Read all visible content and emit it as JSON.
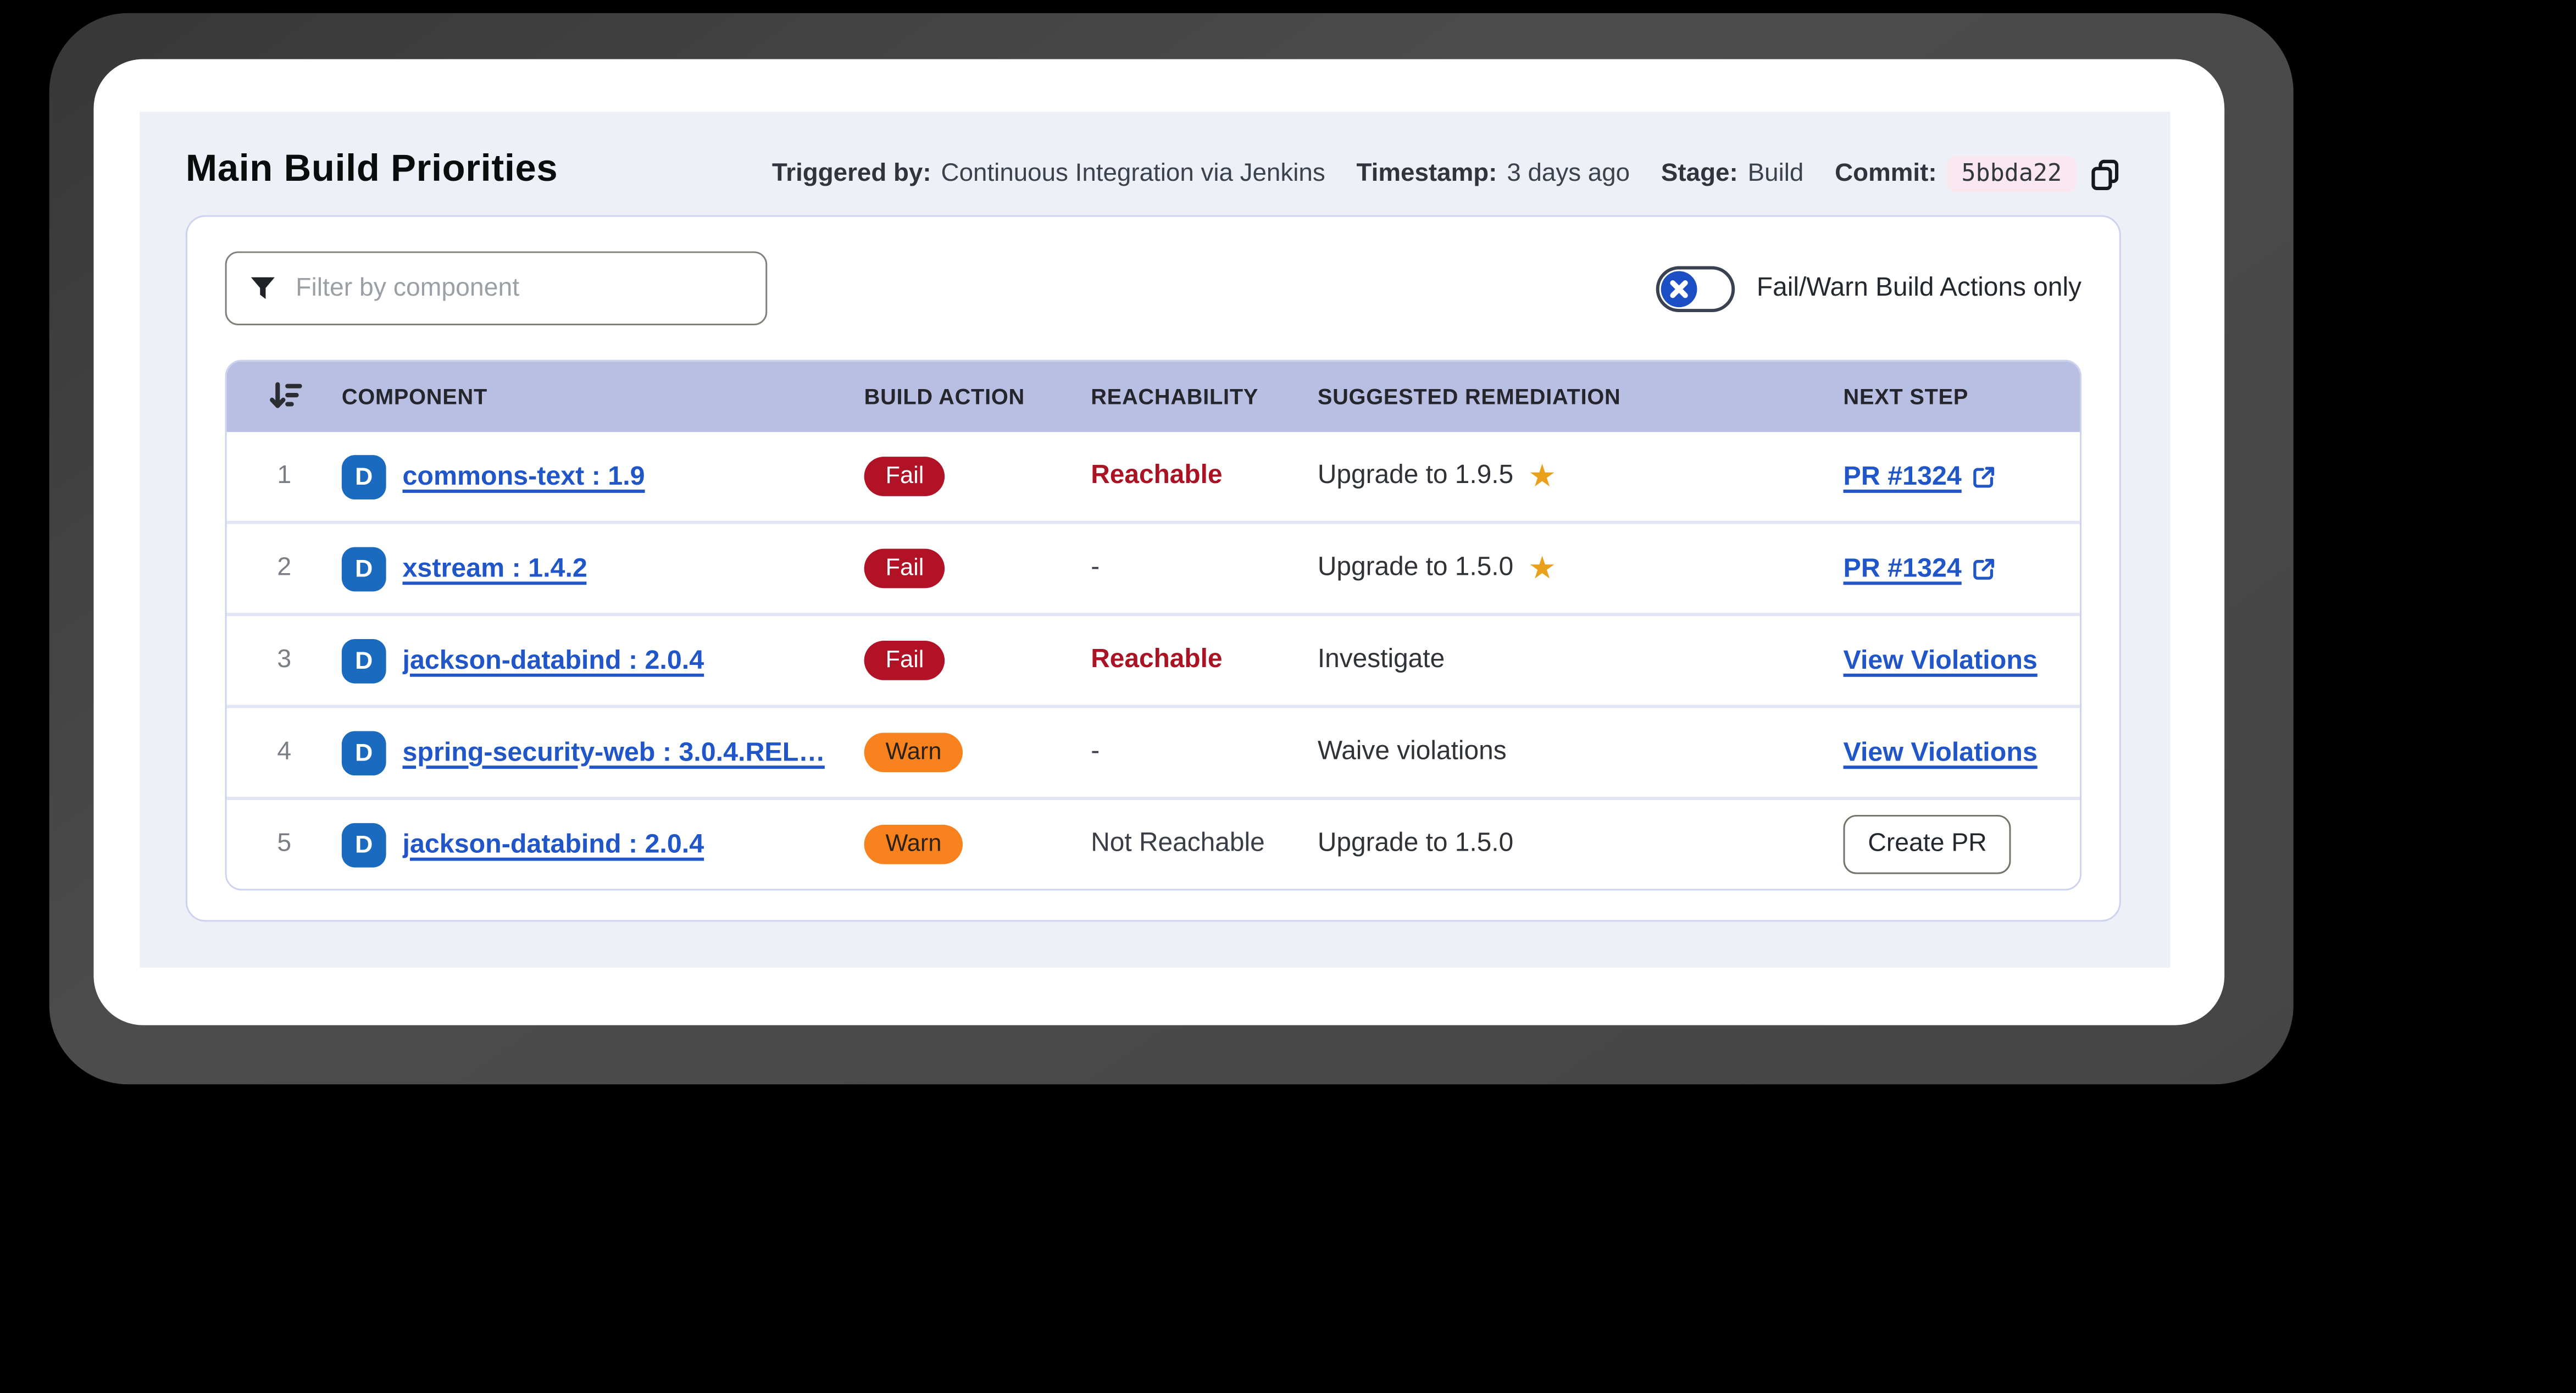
{
  "header": {
    "title": "Main Build Priorities",
    "meta": [
      {
        "label": "Triggered by:",
        "value": "Continuous Integration via Jenkins"
      },
      {
        "label": "Timestamp:",
        "value": "3 days ago"
      },
      {
        "label": "Stage:",
        "value": "Build"
      },
      {
        "label": "Commit:",
        "value": "5bbda22"
      }
    ]
  },
  "toolbar": {
    "filter_placeholder": "Filter by component",
    "toggle_label": "Fail/Warn Build Actions only",
    "toggle_checked": false
  },
  "table": {
    "columns": [
      "COMPONENT",
      "BUILD ACTION",
      "REACHABILITY",
      "SUGGESTED REMEDIATION",
      "NEXT STEP"
    ],
    "rows": [
      {
        "rank": "1",
        "component": "commons-text : 1.9",
        "build_action": "Fail",
        "reachability": "Reachable",
        "reachability_style": "danger",
        "remediation": "Upgrade to 1.9.5",
        "starred": true,
        "next_step": {
          "type": "pr-link",
          "label": "PR #1324"
        }
      },
      {
        "rank": "2",
        "component": "xstream : 1.4.2",
        "build_action": "Fail",
        "reachability": "-",
        "reachability_style": "plain",
        "remediation": "Upgrade to 1.5.0",
        "starred": true,
        "next_step": {
          "type": "pr-link",
          "label": "PR #1324"
        }
      },
      {
        "rank": "3",
        "component": "jackson-databind : 2.0.4",
        "build_action": "Fail",
        "reachability": "Reachable",
        "reachability_style": "danger",
        "remediation": "Investigate",
        "starred": false,
        "next_step": {
          "type": "link",
          "label": "View Violations"
        }
      },
      {
        "rank": "4",
        "component": "spring-security-web : 3.0.4.REL…",
        "build_action": "Warn",
        "reachability": "-",
        "reachability_style": "plain",
        "remediation": "Waive violations",
        "starred": false,
        "next_step": {
          "type": "link",
          "label": "View Violations"
        }
      },
      {
        "rank": "5",
        "component": "jackson-databind : 2.0.4",
        "build_action": "Warn",
        "reachability": "Not Reachable",
        "reachability_style": "plain",
        "remediation": "Upgrade to 1.5.0",
        "starred": false,
        "next_step": {
          "type": "button",
          "label": "Create PR"
        }
      }
    ]
  },
  "colors": {
    "card-bg": "#eef0f7",
    "header-lavender": "#b9bee3",
    "fail-badge": "#b11226",
    "warn-badge": "#f8821d",
    "link-blue": "#2156c8",
    "d-badge-blue": "#1a6ac0",
    "danger-text": "#a91324",
    "star-gold": "#e9a11b",
    "toggle-knob-blue": "#1d4fc4",
    "commit-chip-pink": "#fbe7f0"
  }
}
